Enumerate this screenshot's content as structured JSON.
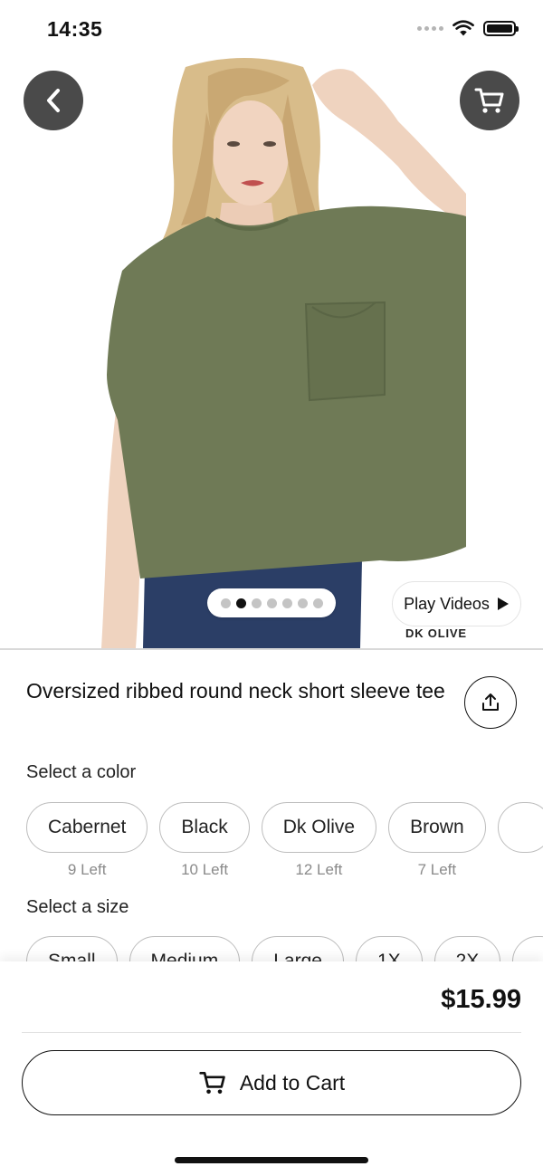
{
  "status_bar": {
    "time": "14:35"
  },
  "product": {
    "title": "Oversized ribbed round neck short sleeve tee",
    "image_color_caption": "DK OLIVE",
    "play_videos_label": "Play Videos",
    "image_count": 7,
    "active_image_index": 1,
    "shirt_color": "#6f7a56"
  },
  "color_section": {
    "label": "Select a color",
    "options": [
      {
        "name": "Cabernet",
        "stock": "9 Left"
      },
      {
        "name": "Black",
        "stock": "10 Left"
      },
      {
        "name": "Dk Olive",
        "stock": "12 Left"
      },
      {
        "name": "Brown",
        "stock": "7 Left"
      },
      {
        "name": "",
        "stock": ""
      }
    ]
  },
  "size_section": {
    "label": "Select a size",
    "options": [
      "Small",
      "Medium",
      "Large",
      "1X",
      "2X",
      ""
    ]
  },
  "checkout": {
    "price": "$15.99",
    "add_to_cart_label": "Add to Cart"
  }
}
